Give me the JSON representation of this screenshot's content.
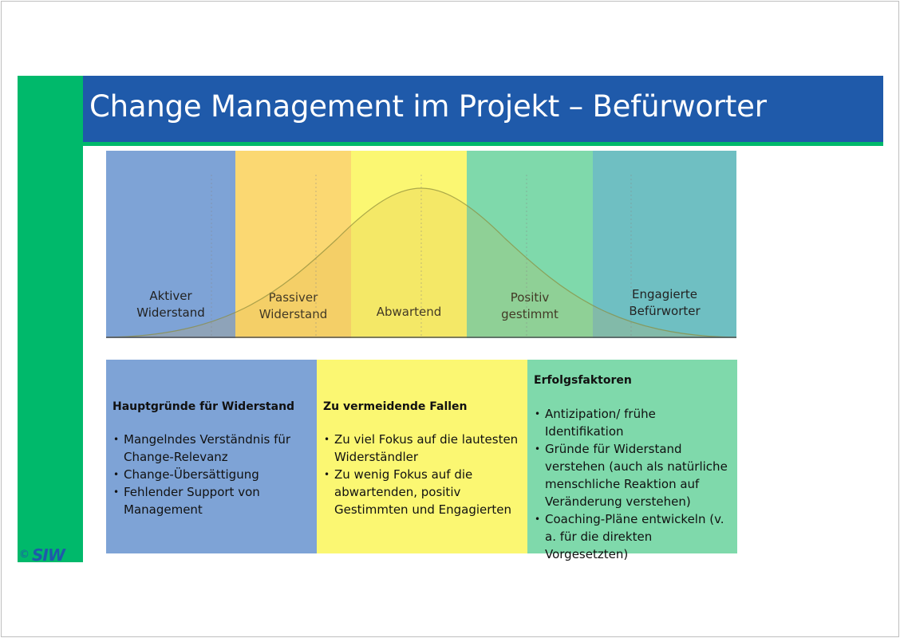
{
  "title": "Change Management im Projekt – Befürworter",
  "stages": [
    {
      "label_line1": "Aktiver",
      "label_line2": "Widerstand",
      "color": "#7ea3d6"
    },
    {
      "label_line1": "Passiver",
      "label_line2": "Widerstand",
      "color": "#fbd872"
    },
    {
      "label_line1": "Abwartend",
      "label_line2": "",
      "color": "#fbf772"
    },
    {
      "label_line1": "Positiv",
      "label_line2": "gestimmt",
      "color": "#7fd9ab"
    },
    {
      "label_line1": "Engagierte",
      "label_line2": "Befürworter",
      "color": "#6fbfc2"
    }
  ],
  "boxes": {
    "reasons": {
      "heading": "Hauptgründe für Widerstand",
      "color": "#7ea3d6",
      "items": [
        "Mangelndes Verständnis für Change-Relevanz",
        "Change-Übersättigung",
        "Fehlender Support von Management"
      ]
    },
    "traps": {
      "heading": "Zu vermeidende Fallen",
      "color": "#fbf772",
      "items": [
        "Zu viel Fokus auf die lautesten Widerständler",
        "Zu wenig Fokus auf die abwartenden, positiv Gestimmten und Engagierten"
      ]
    },
    "success": {
      "heading": "Erfolgsfaktoren",
      "color": "#7fd9ab",
      "items": [
        "Antizipation/ frühe Identifikation",
        "Gründe für Widerstand verstehen (auch als natürliche menschliche Reaktion auf Veränderung verstehen)",
        "Coaching-Pläne entwickeln (v. a. für die direkten Vorgesetzten)"
      ]
    }
  },
  "footer": {
    "copyright": "©",
    "logo": "SIW"
  },
  "colors": {
    "title_bar": "#1f5aaa",
    "accent_green": "#00b96b"
  }
}
